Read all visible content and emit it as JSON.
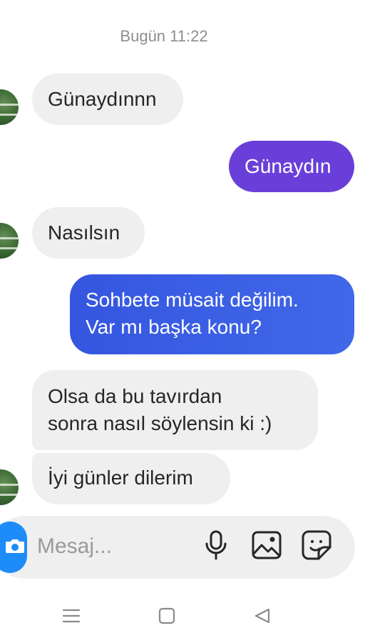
{
  "chat": {
    "timestamp": "Bugün 11:22",
    "messages": [
      {
        "from": "them",
        "text": "Günaydınnn"
      },
      {
        "from": "me",
        "text": "Günaydın"
      },
      {
        "from": "them",
        "text": "Nasılsın"
      },
      {
        "from": "me",
        "lines": [
          "Sohbete müsait değilim.",
          "Var mı başka konu?"
        ]
      },
      {
        "from": "them",
        "lines": [
          "Olsa da bu tavırdan",
          "sonra nasıl söylensin ki :)"
        ]
      },
      {
        "from": "them",
        "text": "İyi günler dilerim"
      }
    ]
  },
  "composer": {
    "placeholder": "Mesaj...",
    "icons": [
      "camera-icon",
      "microphone-icon",
      "gallery-icon",
      "sticker-icon"
    ]
  },
  "navbar": {
    "icons": [
      "menu-icon",
      "home-icon",
      "back-icon"
    ]
  },
  "colors": {
    "bubble_in": "#efefef",
    "bubble_out_purple": "#6a3fd9",
    "bubble_out_blue": "#3b5ce6",
    "camera_button": "#1d8cf8",
    "timestamp": "#8e8e8e"
  }
}
